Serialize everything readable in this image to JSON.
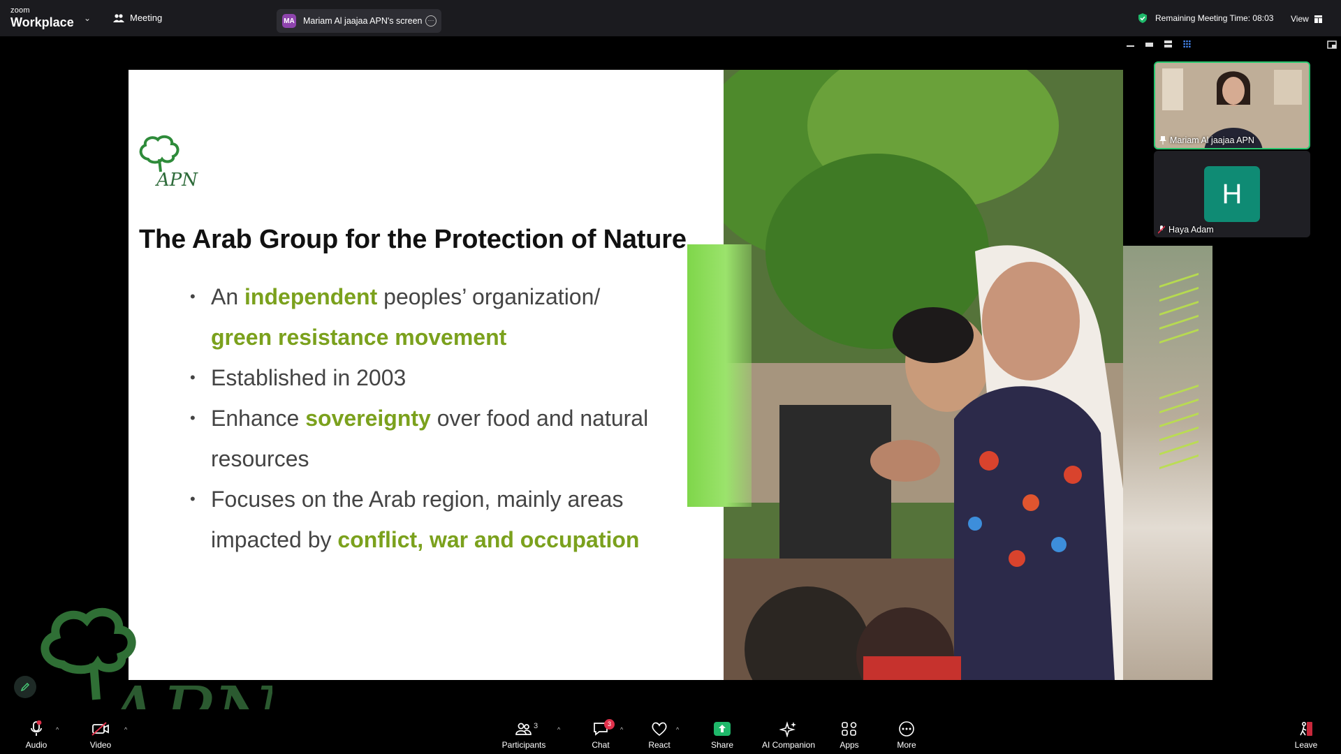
{
  "app": {
    "brand_small": "zoom",
    "brand_big": "Workplace",
    "meeting_label": "Meeting"
  },
  "share_pill": {
    "avatar_initials": "MA",
    "text": "Mariam Al jaajaa APN's screen"
  },
  "status": {
    "remaining": "Remaining Meeting Time: 08:03",
    "view_label": "View"
  },
  "slide": {
    "logo_text": "APN",
    "title": "The Arab Group for the Protection of Nature",
    "bullets": [
      {
        "pre": "An ",
        "hl": "independent",
        "post": " peoples’ organization/",
        "line2_hl": "green resistance movement"
      },
      {
        "text": "Established in 2003"
      },
      {
        "pre": "Enhance ",
        "hl": "sovereignty",
        "post": " over food and natural resources"
      },
      {
        "pre": "Focuses on the Arab region, mainly areas impacted by ",
        "hl": "conflict, war and occupation"
      }
    ],
    "watermark_text": "APN"
  },
  "participants": [
    {
      "name": "Mariam Al jaajaa APN",
      "pinned": true
    },
    {
      "name": "Haya Adam",
      "avatar": "H",
      "muted": true
    }
  ],
  "toolbar": {
    "audio": "Audio",
    "video": "Video",
    "participants": "Participants",
    "participants_count": "3",
    "chat": "Chat",
    "chat_badge": "3",
    "react": "React",
    "share": "Share",
    "ai_companion": "AI Companion",
    "apps": "Apps",
    "more": "More",
    "leave": "Leave"
  },
  "colors": {
    "highlight": "#7ba11d",
    "avatar_h": "#0f8b74",
    "share_green": "#1fb86a",
    "active_border": "#28c76f"
  },
  "icons": [
    "zoom-logo",
    "meeting-icon",
    "more-options-icon",
    "shield-check-icon",
    "grid-view-icon",
    "pencil-icon",
    "mic-muted-icon",
    "video-off-icon",
    "people-icon",
    "chat-icon",
    "heart-icon",
    "share-arrow-icon",
    "sparkle-icon",
    "apps-icon",
    "ellipsis-icon",
    "leave-icon"
  ]
}
